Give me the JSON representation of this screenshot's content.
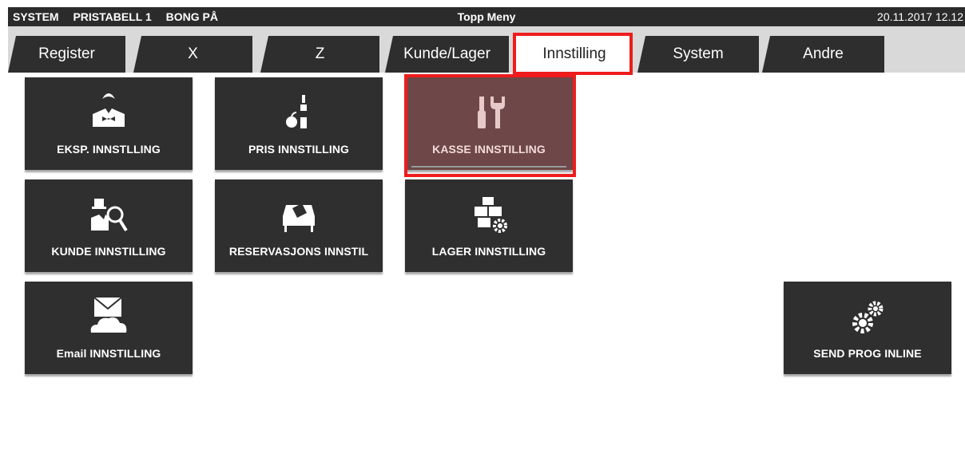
{
  "statusbar": {
    "system": "SYSTEM",
    "pricelist": "PRISTABELL 1",
    "bong": "BONG PÅ",
    "title": "Topp Meny",
    "datetime": "20.11.2017 12.12"
  },
  "tabs": [
    {
      "label": "Register"
    },
    {
      "label": "X"
    },
    {
      "label": "Z"
    },
    {
      "label": "Kunde/Lager"
    },
    {
      "label": "Innstilling",
      "active": true
    },
    {
      "label": "System"
    },
    {
      "label": "Andre"
    }
  ],
  "tiles": {
    "eksp": {
      "label": "EKSP. INNSTLLING",
      "icon": "waiter-icon"
    },
    "pris": {
      "label": "PRIS INNSTILLING",
      "icon": "price-goods-icon"
    },
    "kasse": {
      "label": "KASSE INNSTILLING",
      "icon": "tools-icon",
      "selected": true
    },
    "kunde": {
      "label": "KUNDE INNSTILLING",
      "icon": "customer-search-icon"
    },
    "reservasjon": {
      "label": "RESERVASJONS INNSTIL",
      "icon": "reserved-table-icon"
    },
    "lager": {
      "label": "LAGER INNSTILLING",
      "icon": "warehouse-gear-icon"
    },
    "email": {
      "label": "Email INNSTILLING",
      "icon": "email-cloud-icon"
    },
    "send": {
      "label": "SEND PROG INLINE",
      "icon": "gears-icon"
    }
  },
  "colors": {
    "bar": "#2b2b2b",
    "tile": "#2f2f2f",
    "tile_selected": "#6e4848",
    "highlight": "#ee1c1c"
  }
}
